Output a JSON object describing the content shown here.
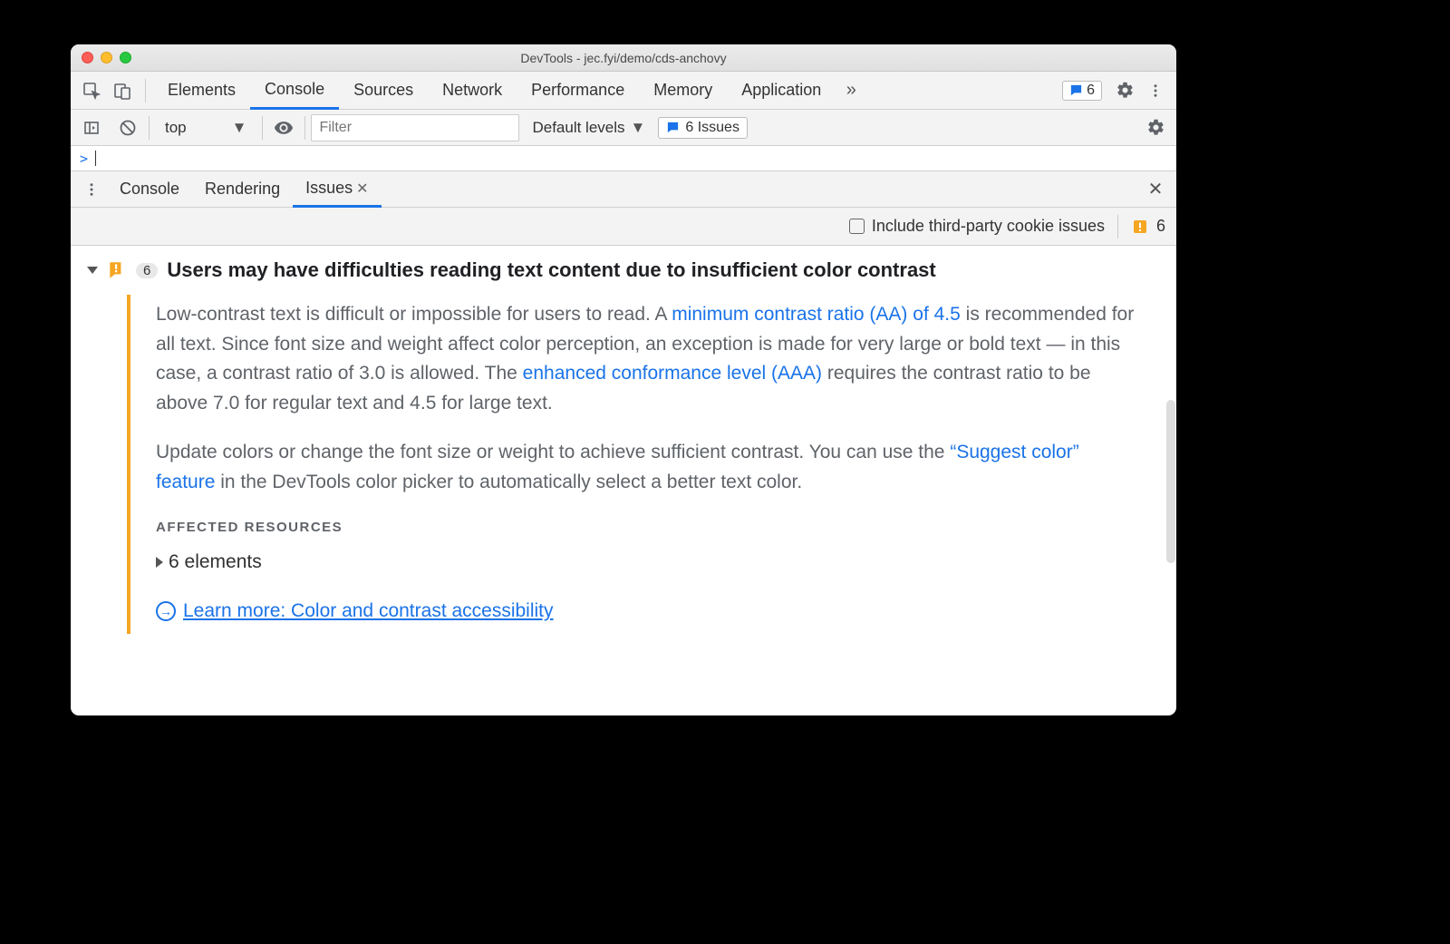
{
  "window": {
    "title": "DevTools - jec.fyi/demo/cds-anchovy"
  },
  "main_tabs": {
    "items": [
      "Elements",
      "Console",
      "Sources",
      "Network",
      "Performance",
      "Memory",
      "Application"
    ],
    "active_index": 1,
    "issues_badge_count": "6"
  },
  "console_toolbar": {
    "context": "top",
    "filter_placeholder": "Filter",
    "levels_label": "Default levels",
    "issues_chip": "6 Issues"
  },
  "console_prompt": {
    "symbol": ">"
  },
  "drawer": {
    "tabs": [
      "Console",
      "Rendering",
      "Issues"
    ],
    "active_index": 2
  },
  "issues_toolbar": {
    "checkbox_label": "Include third-party cookie issues",
    "count": "6"
  },
  "issue": {
    "count_badge": "6",
    "title": "Users may have difficulties reading text content due to insufficient color contrast",
    "p1_a": "Low-contrast text is difficult or impossible for users to read. A ",
    "link1": "minimum contrast ratio (AA) of 4.5",
    "p1_b": " is recommended for all text. Since font size and weight affect color perception, an exception is made for very large or bold text — in this case, a contrast ratio of 3.0 is allowed. The ",
    "link2": "enhanced conformance level (AAA)",
    "p1_c": " requires the contrast ratio to be above 7.0 for regular text and 4.5 for large text.",
    "p2_a": "Update colors or change the font size or weight to achieve sufficient contrast. You can use the ",
    "link3": "“Suggest color” feature",
    "p2_b": " in the DevTools color picker to automatically select a better text color.",
    "affected_label": "AFFECTED RESOURCES",
    "affected_row": "6 elements",
    "learn_more": "Learn more: Color and contrast accessibility"
  }
}
